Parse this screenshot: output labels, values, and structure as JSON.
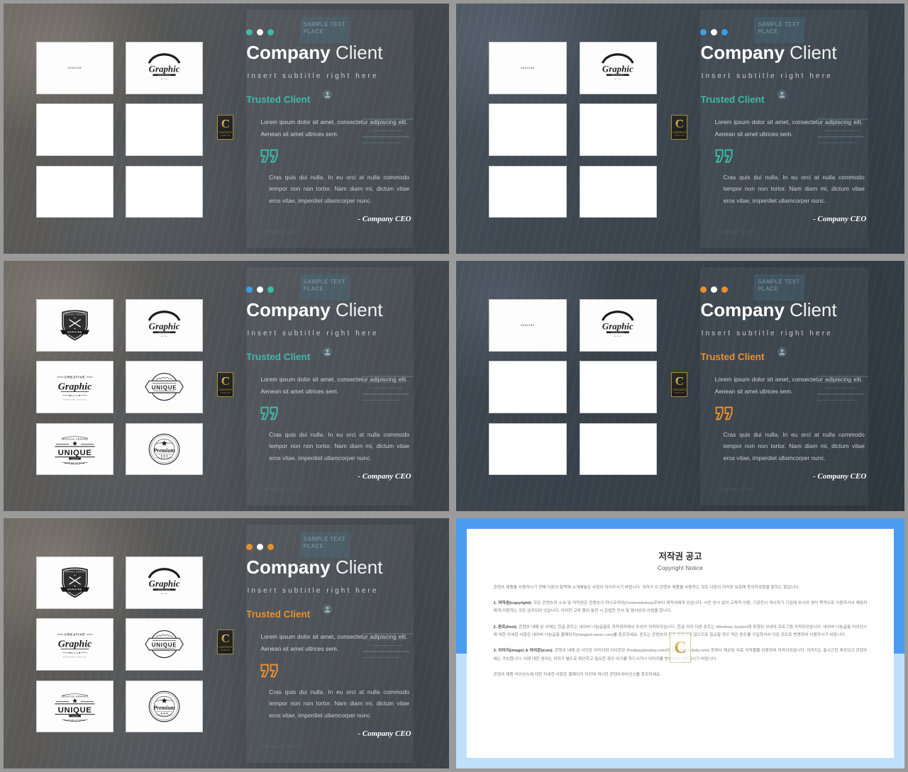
{
  "slide": {
    "title_bold": "Company",
    "title_light": "Client",
    "subtitle": "Insert subtitle right here",
    "section_label": "Trusted Client",
    "body_text": "Lorem ipsum dolor sit amet, consectetur adipiscing elit. Aenean sit amet ultrices sem.",
    "quote_text": "Cras quis dui nulla. In eu orci at nulla commodo tempor non non tortor. Nam diam mi, dictum vitae eros vitae, imperdiet ullamcorper nunc.",
    "attribution": "- Company CEO",
    "watermark_label": "SAMPLE TEXT PLACE",
    "ghost_caption": "Company Client",
    "badge_letter": "C",
    "badge_sub": "CONTENTS",
    "badge_sub2": "TEMPLATE"
  },
  "panels": [
    {
      "id": "panel-1",
      "accent": "#3fb8a8",
      "dot_colors": [
        "#3fb8a8",
        "#ffffff",
        "#3fb8a8"
      ],
      "theme": "warm",
      "logos": [
        "genuine-plain",
        "graphic-arch",
        null,
        null,
        null,
        null
      ]
    },
    {
      "id": "panel-2",
      "accent": "#3fb8a8",
      "dot_colors": [
        "#3d9ee0",
        "#ffffff",
        "#3d9ee0"
      ],
      "theme": "dark",
      "logos": [
        "genuine-plain",
        "graphic-arch",
        null,
        null,
        null,
        null
      ]
    },
    {
      "id": "panel-3",
      "accent": "#3fb8a8",
      "dot_colors": [
        "#3d9ee0",
        "#ffffff",
        "#3fb8a8"
      ],
      "theme": "warm",
      "logos": [
        "shield-genuine",
        "graphic-arch",
        "creative-graphic",
        "unique-badge",
        "unique-bold",
        "premium-seal"
      ]
    },
    {
      "id": "panel-4",
      "accent": "#e8902e",
      "dot_colors": [
        "#e8902e",
        "#ffffff",
        "#e8902e"
      ],
      "theme": "dark",
      "logos": [
        "genuine-plain",
        "graphic-arch",
        null,
        null,
        null,
        null
      ]
    },
    {
      "id": "panel-5",
      "accent": "#e8902e",
      "dot_colors": [
        "#e8902e",
        "#ffffff",
        "#e8902e"
      ],
      "theme": "warm",
      "logos": [
        "shield-genuine",
        "graphic-arch",
        "creative-graphic",
        "unique-badge",
        "unique-bold",
        "premium-seal"
      ]
    }
  ],
  "logo_labels": {
    "genuine-plain": "GENUINE",
    "graphic-arch": "INSPIRATIONAL Graphic",
    "shield-genuine": "GRAPHIC DESIGN GENUINE",
    "creative-graphic": "CREATIVE Graphic DESIGN",
    "unique-badge": "UNIQUE",
    "unique-bold": "CREATIVE GRAPHIC UNIQUE DESIGN STUDIO",
    "premium-seal": "Premium"
  },
  "copyright": {
    "title": "저작권 공고",
    "subtitle": "Copyright Notice",
    "intro": "콘텐츠 제품을 사용하시기 전에 다음의 항목에 소개해놓은 사항이 되어주시기 바랍니다. 귀하가 이 콘텐츠 제품을 사용하는 것은 다음의 저작권 보호에 동의하셨음을 말하는 말입니다.",
    "s1_label": "1. 저작권(copyright):",
    "s1_text": "모든 콘텐츠의 소유 및 저작권은 콘텐츠의 하나코리아(Contentskorea)로부터 제작사에게 있습니다. 사전 승낙 없이 교육적 이용, 기관전시 게시하기 기업에 상시이 영리 목적으로 이용하셔서 제삼자에게 이용하는 것은 금지되어 있습니다. 이러한 교육 행위 발견 시 준법한 민사 및 형사상의 사법을 합니다.",
    "s2_label": "2. 폰트(font):",
    "s2_text": "콘텐츠 내에 된 서체는 한글 폰트는 네이버 나눔글꼴로 저작권자에서 무상이 저작되었습니다. 한글 외의 다른 폰트는 Windows System에 포함된 사내의 프로그램 저작되었습니다. 네이버 나눔글꼴 라이선스에 대한 자세한 사항은 네이버 나눔글꼴 홈페이지(hangeul.naver.com)를 참조하세요. 폰트는 콘텐츠의 함께 제공되지 않으므로 필요할 경우 적은 폰트를 구입하셔서 다운 폰트로 변경하여 사용하시기 바랍니다.",
    "s3_label": "3. 이미지(image) & 아이콘(icon):",
    "s3_text": "콘텐츠 내에 된 사진은 이미지와 아이콘은 Pixabay(pixabay.com)와 Weboly(weboly.com) 등에서 제공된 무료 저작물을 이용하여 저작되었습니다. 이미지는 출시근한 제공되고 콘텐츠에는 가능합니다. 이에 대한 권리는 귀하가 별도로 확인하고 필요한 경우 여기를 하드시거나 이미지를 변경하여 사용하시기 바랍니다.",
    "footer": "콘텐츠 제품 라이선스에 대한 자세한 사항은 홈페이지 하단에 게시한 콘텐츠라이선스를 참조하세요.",
    "watermark_letter": "C"
  }
}
